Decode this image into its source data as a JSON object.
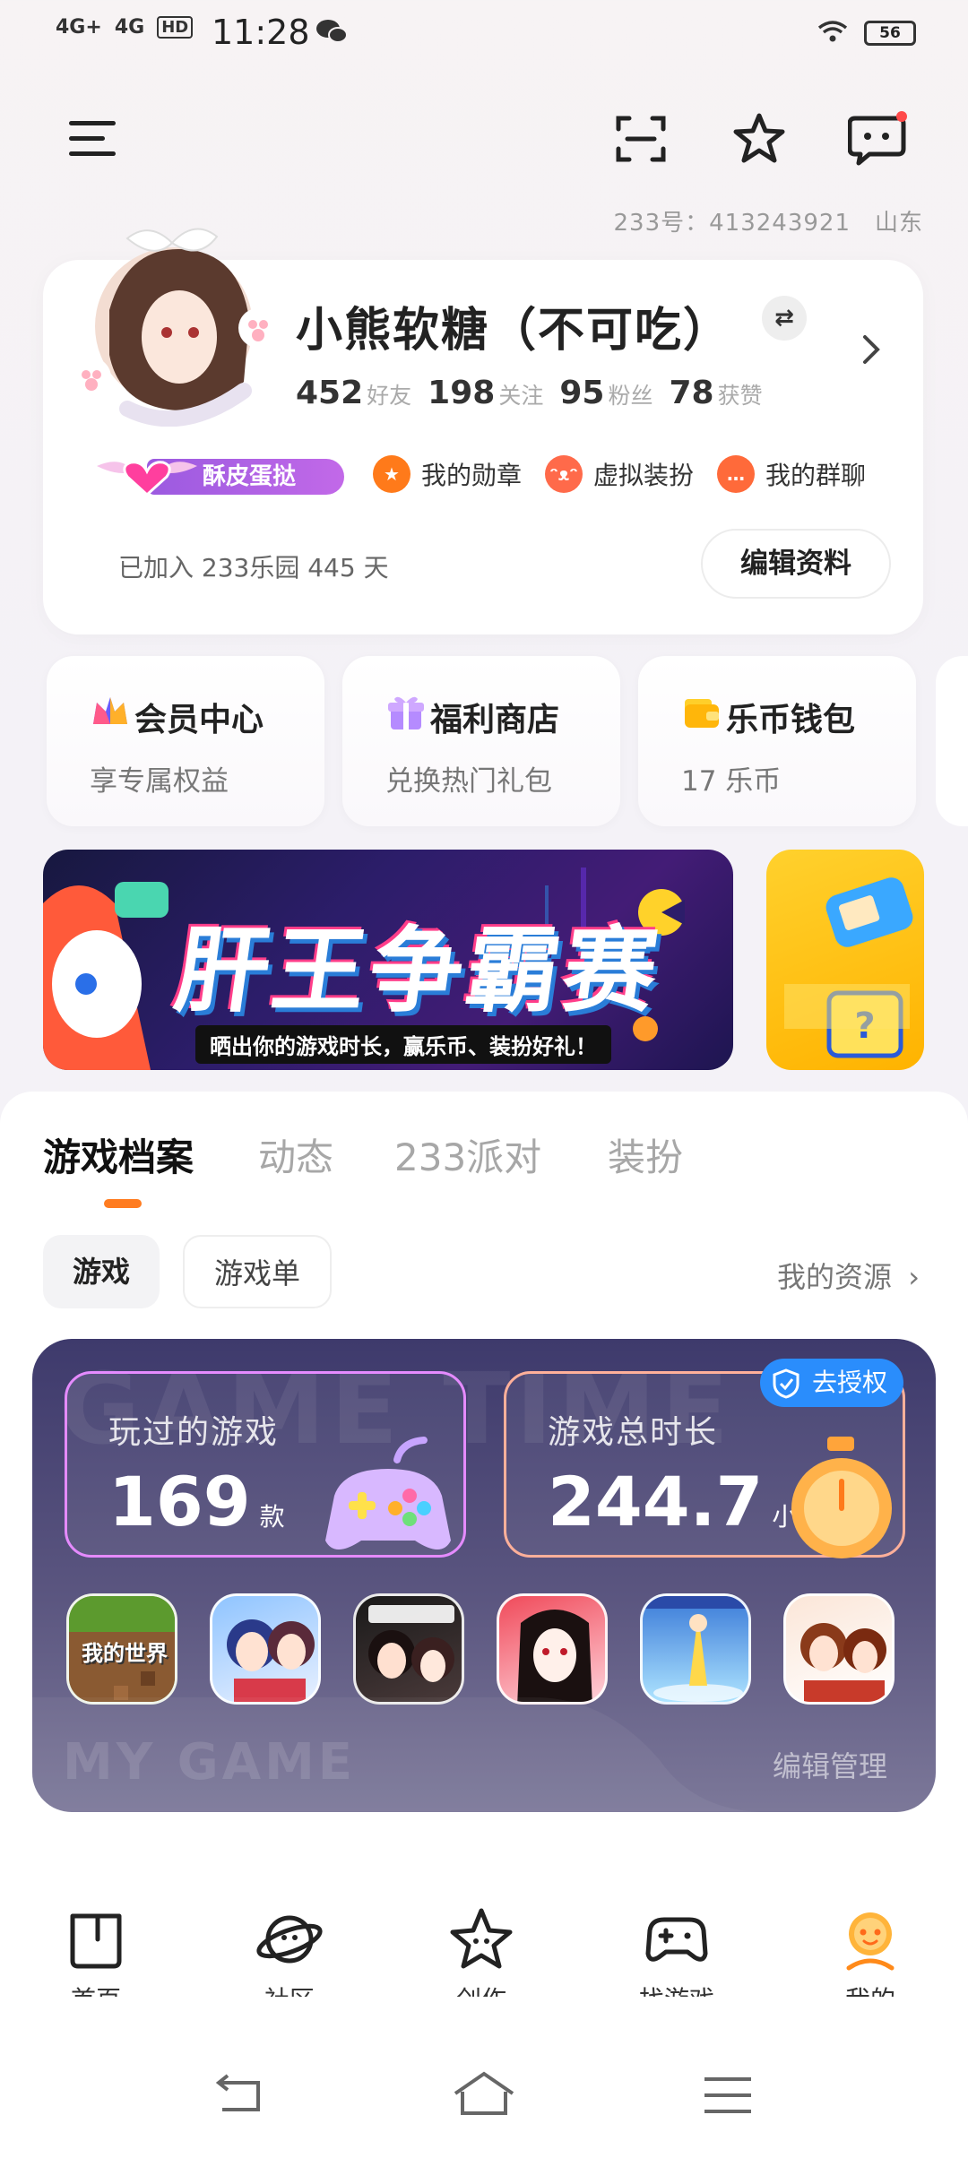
{
  "status_bar": {
    "net1": "4G+",
    "net2": "4G",
    "hd": "HD",
    "time": "11:28",
    "battery": "56"
  },
  "header": {
    "user_id_line": "233号：413243921　山东"
  },
  "profile": {
    "nickname": "小熊软糖（不可吃）",
    "stats": [
      {
        "num": "452",
        "label": "好友"
      },
      {
        "num": "198",
        "label": "关注"
      },
      {
        "num": "95",
        "label": "粉丝"
      },
      {
        "num": "78",
        "label": "获赞"
      }
    ],
    "vip_tag": "酥皮蛋挞",
    "entries": [
      {
        "label": "我的勋章",
        "icon": "medal-icon",
        "color": "#ff7a1a"
      },
      {
        "label": "虚拟装扮",
        "icon": "cat-face-icon",
        "color": "#ff6a4a"
      },
      {
        "label": "我的群聊",
        "icon": "chat-bubble-icon",
        "color": "#ff6a3a"
      }
    ],
    "joined_text": "已加入 233乐园 445 天",
    "edit_button": "编辑资料"
  },
  "quick_cards": [
    {
      "title": "会员中心",
      "subtitle": "享专属权益",
      "icon": "crown-icon"
    },
    {
      "title": "福利商店",
      "subtitle": "兑换热门礼包",
      "icon": "gift-icon"
    },
    {
      "title": "乐币钱包",
      "subtitle": "17 乐币",
      "icon": "wallet-icon"
    }
  ],
  "banner": {
    "title": "肝王争霸赛",
    "subtitle": "晒出你的游戏时长，赢乐币、装扮好礼！"
  },
  "tabs": [
    "游戏档案",
    "动态",
    "233派对",
    "装扮"
  ],
  "chips": {
    "on": "游戏",
    "off": "游戏单"
  },
  "resources_link": "我的资源",
  "game_panel": {
    "bg_text": "GAME TIME",
    "played_label": "玩过的游戏",
    "played_num": "169",
    "played_unit": "款",
    "time_label": "游戏总时长",
    "time_num": "244.7",
    "time_unit": "小时",
    "auth_badge": "去授权",
    "my_game_text": "MY GAME",
    "edit_manage": "编辑管理",
    "game_icon_text": "我的世界"
  },
  "bottom_nav": [
    {
      "label": "首页",
      "icon": "home-icon"
    },
    {
      "label": "社区",
      "icon": "planet-icon"
    },
    {
      "label": "创作",
      "icon": "star-icon"
    },
    {
      "label": "找游戏",
      "icon": "gamepad-icon"
    },
    {
      "label": "我的",
      "icon": "profile-icon"
    }
  ],
  "colors": {
    "accent": "#ff7c20",
    "vip": "#9b5ae0",
    "auth_blue": "#2a8dfc"
  }
}
